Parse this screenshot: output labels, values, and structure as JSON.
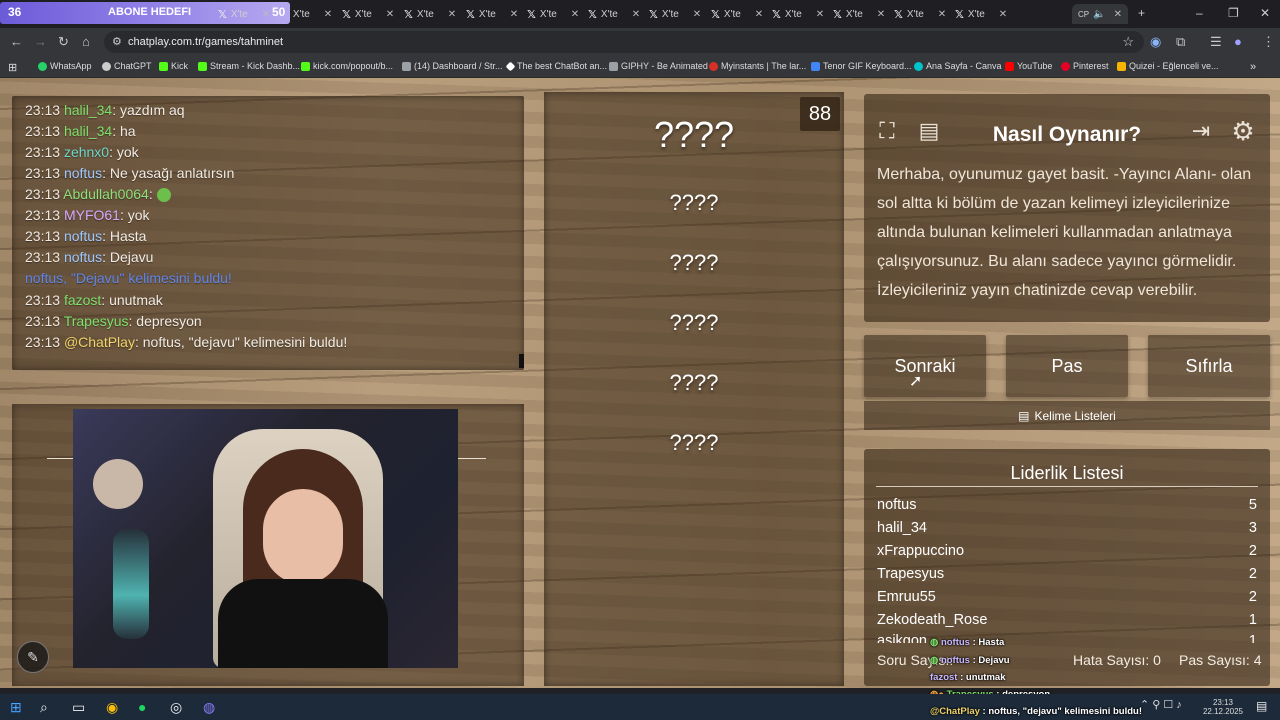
{
  "browser": {
    "sub_goal": {
      "count": "36",
      "label": "ABONE HEDEFI",
      "target": "50"
    },
    "tabs": [
      {
        "label": "X'te"
      },
      {
        "label": "X'te"
      },
      {
        "label": "X'te"
      },
      {
        "label": "X'te"
      },
      {
        "label": "X'te"
      },
      {
        "label": "X'te"
      },
      {
        "label": "X'te"
      },
      {
        "label": "X'te"
      },
      {
        "label": "X'te"
      },
      {
        "label": "X'te"
      },
      {
        "label": "X'te"
      },
      {
        "label": "X'te"
      },
      {
        "label": "X'te"
      }
    ],
    "active_tab": "CP",
    "url": "chatplay.com.tr/games/tahminet",
    "bookmarks": [
      {
        "label": "WhatsApp",
        "color": "#25d366"
      },
      {
        "label": "ChatGPT",
        "color": "#cccccc"
      },
      {
        "label": "Kick",
        "color": "#53fc18"
      },
      {
        "label": "Stream - Kick Dashb...",
        "color": "#53fc18"
      },
      {
        "label": "kick.com/popout/b...",
        "color": "#53fc18"
      },
      {
        "label": "(14) Dashboard / Str...",
        "color": "#9aa0a6"
      },
      {
        "label": "The best ChatBot an...",
        "color": "#ffffff"
      },
      {
        "label": "GIPHY - Be Animated",
        "color": "#9aa0a6"
      },
      {
        "label": "Myinstants | The lar...",
        "color": "#d93025"
      },
      {
        "label": "Tenor GIF Keyboard...",
        "color": "#4285f4"
      },
      {
        "label": "Ana Sayfa - Canva",
        "color": "#00c4cc"
      },
      {
        "label": "YouTube",
        "color": "#ff0000"
      },
      {
        "label": "Pinterest",
        "color": "#e60023"
      },
      {
        "label": "Quizei - Eğlenceli ve...",
        "color": "#f4b400"
      }
    ]
  },
  "chat": {
    "messages": [
      {
        "time": "23:13",
        "user": "halil_34",
        "text": ": yazdım aq",
        "color": "#7ee06b"
      },
      {
        "time": "23:13",
        "user": "halil_34",
        "text": ": ha",
        "color": "#7ee06b"
      },
      {
        "time": "23:13",
        "user": "zehnx0",
        "text": ": yok",
        "color": "#6fd6c8"
      },
      {
        "time": "23:13",
        "user": "noftus",
        "text": ": Ne yasağı anlatırsın",
        "color": "#9ec9ff"
      },
      {
        "time": "23:13",
        "user": "Abdullah0064",
        "text": ":",
        "color": "#8ee07a"
      },
      {
        "time": "23:13",
        "user": "MYFO61",
        "text": ": yok",
        "color": "#d8a8ff"
      },
      {
        "time": "23:13",
        "user": "noftus",
        "text": ": Hasta",
        "color": "#9ec9ff"
      },
      {
        "time": "23:13",
        "user": "noftus",
        "text": ": Dejavu",
        "color": "#9ec9ff"
      },
      {
        "time": "",
        "user": "",
        "text": "noftus, \"Dejavu\" kelimesini buldu!",
        "color": "#5f86e8"
      },
      {
        "time": "23:13",
        "user": "fazost",
        "text": ": unutmak",
        "color": "#7ee06b"
      },
      {
        "time": "23:13",
        "user": "Trapesyus",
        "text": ": depresyon",
        "color": "#7ee06b"
      },
      {
        "time": "23:13",
        "user": "@ChatPlay",
        "text": ": noftus, \"dejavu\" kelimesini buldu!",
        "color": "#f0d36a"
      }
    ]
  },
  "game": {
    "timer": "88",
    "main_word": "????",
    "words": [
      "????",
      "????",
      "????",
      "????",
      "????"
    ]
  },
  "howto": {
    "title": "Nasıl Oynanır?",
    "text": "Merhaba, oyunumuz gayet basit. -Yayıncı Alanı- olan sol altta ki bölüm de yazan kelimeyi izleyicilerinize altında bulunan kelimeleri kullanmadan anlatmaya çalışıyorsunuz. Bu alanı sadece yayıncı görmelidir. İzleyicileriniz yayın chatinizde cevap verebilir."
  },
  "controls": {
    "next": "Sonraki",
    "pass": "Pas",
    "reset": "Sıfırla",
    "lists": "Kelime Listeleri"
  },
  "leaderboard": {
    "title": "Liderlik Listesi",
    "rows": [
      {
        "name": "noftus",
        "score": "5"
      },
      {
        "name": "halil_34",
        "score": "3"
      },
      {
        "name": "xFrappuccino",
        "score": "2"
      },
      {
        "name": "Trapesyus",
        "score": "2"
      },
      {
        "name": "Emruu55",
        "score": "2"
      },
      {
        "name": "Zekodeath_Rose",
        "score": "1"
      },
      {
        "name": "asikgon",
        "score": "1"
      }
    ],
    "question_count_label": "Soru Sayısı:",
    "error_count": "Hata Sayısı: 0",
    "pass_count": "Pas Sayısı: 4"
  },
  "overlay_chat": [
    {
      "user": "noftus",
      "text": " : Hasta"
    },
    {
      "user": "noftus",
      "text": " : Dejavu"
    },
    {
      "user": "fazost",
      "text": " : unutmak"
    },
    {
      "user": "Trapesyus",
      "text": " : depresyon"
    },
    {
      "user": "@ChatPlay",
      "text": " : noftus, \"dejavu\" kelimesini buldu!"
    }
  ],
  "taskbar": {
    "time": "23:13",
    "date": "22.12.2025"
  }
}
